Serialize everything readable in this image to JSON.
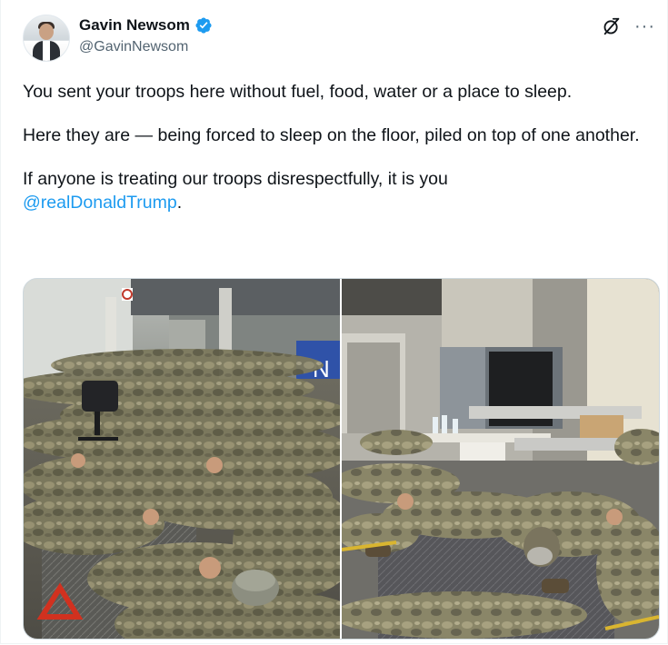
{
  "author": {
    "display_name": "Gavin Newsom",
    "handle": "@GavinNewsom",
    "verified": true,
    "verified_color": "#1d9bf0",
    "avatar_icon": "profile-photo"
  },
  "actions": {
    "grok_icon": "grok-icon",
    "more_label": "···"
  },
  "tweet": {
    "paragraph_1": "You sent your troops here without fuel, food, water or a place to sleep.",
    "paragraph_2": "Here they are — being forced to sleep on the floor, piled on top of one another.",
    "paragraph_3_text": "If anyone is treating our troops disrespectfully, it is you",
    "mention": "@realDonaldTrump",
    "mention_trailing": ".",
    "link_color": "#1d9bf0"
  },
  "media": {
    "count": 2,
    "left_sign_letter": "N"
  }
}
